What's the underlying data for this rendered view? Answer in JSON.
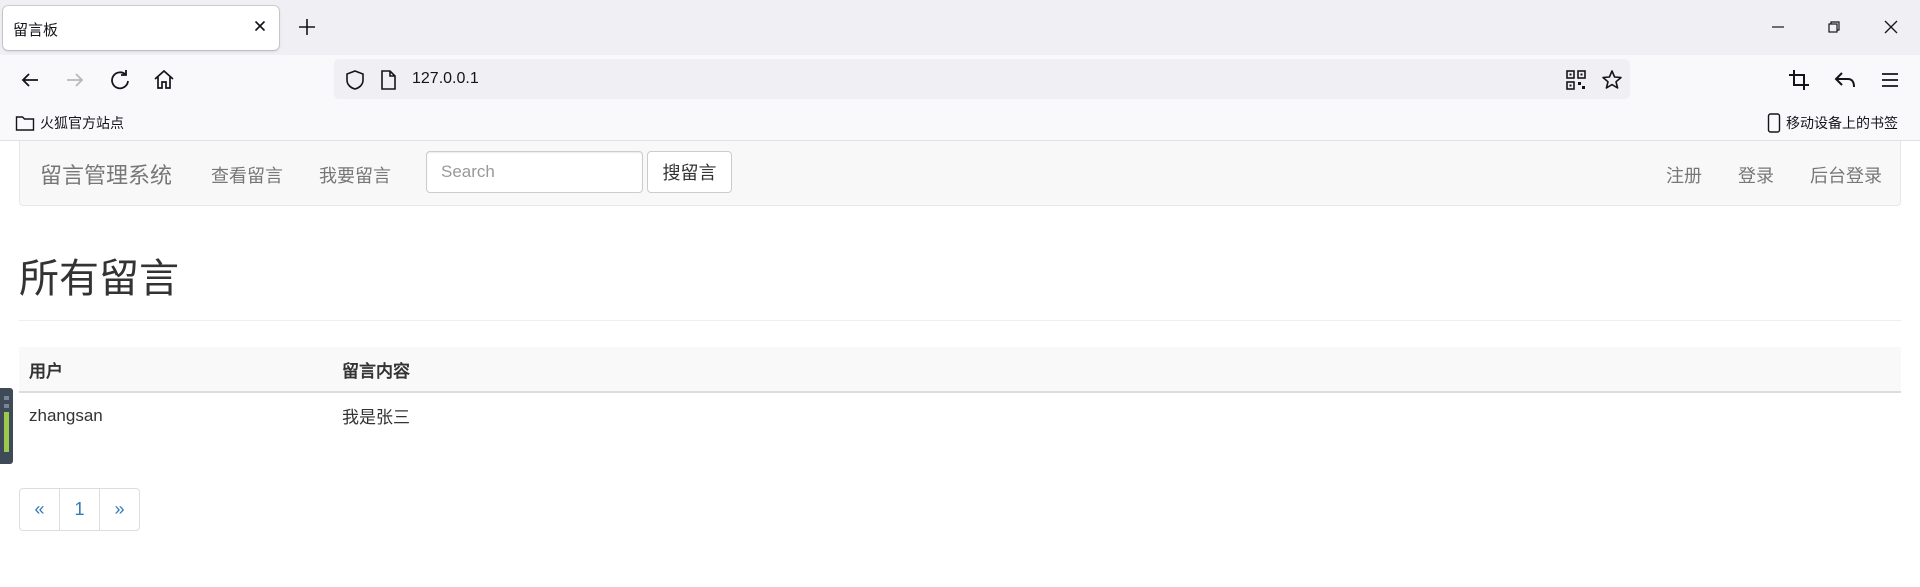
{
  "browser": {
    "tab_title": "留言板",
    "url": "127.0.0.1",
    "bookmarks": {
      "left_folder": "火狐官方站点",
      "right_folder": "移动设备上的书签"
    }
  },
  "site": {
    "brand": "留言管理系统",
    "nav_left": [
      "查看留言",
      "我要留言"
    ],
    "search_placeholder": "Search",
    "search_button": "搜留言",
    "nav_right": [
      "注册",
      "登录",
      "后台登录"
    ]
  },
  "main": {
    "title": "所有留言",
    "table": {
      "headers": [
        "用户",
        "留言内容"
      ],
      "rows": [
        [
          "zhangsan",
          "我是张三"
        ]
      ]
    },
    "pagination": [
      "«",
      "1",
      "»"
    ]
  },
  "colors": {
    "link": "#337ab7",
    "nav_text": "#777777",
    "nav_bg": "#f8f8f8"
  }
}
